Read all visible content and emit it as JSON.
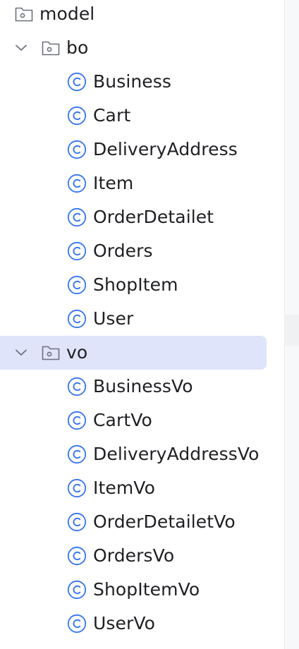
{
  "tree": {
    "root": {
      "label": "model",
      "icon": "folder-icon"
    },
    "packages": [
      {
        "label": "bo",
        "expanded": true,
        "icon": "folder-icon",
        "classes": [
          "Business",
          "Cart",
          "DeliveryAddress",
          "Item",
          "OrderDetailet",
          "Orders",
          "ShopItem",
          "User"
        ]
      },
      {
        "label": "vo",
        "expanded": true,
        "selected": true,
        "icon": "folder-icon",
        "classes": [
          "BusinessVo",
          "CartVo",
          "DeliveryAddressVo",
          "ItemVo",
          "OrderDetailetVo",
          "OrdersVo",
          "ShopItemVo",
          "UserVo"
        ]
      }
    ],
    "class_icon": "class-icon"
  },
  "colors": {
    "text": "#1e1f22",
    "selection": "#dfe4fa",
    "class_icon": "#3574f0",
    "folder_icon": "#6c707e"
  }
}
